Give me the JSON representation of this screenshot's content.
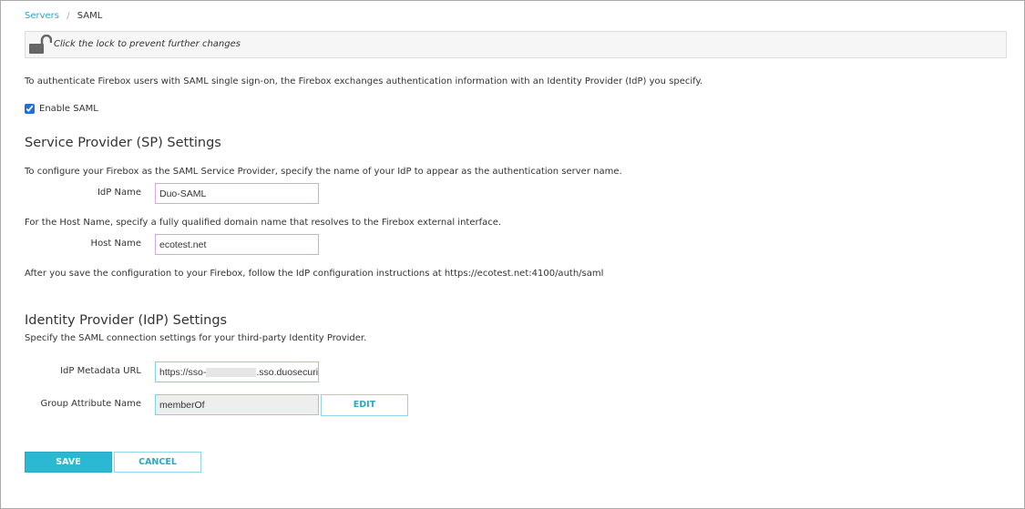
{
  "breadcrumb": {
    "parent": "Servers",
    "separator": "/",
    "current": "SAML"
  },
  "lock": {
    "message": "Click the lock to prevent further changes",
    "icon": "unlocked-padlock-icon"
  },
  "intro": "To authenticate Firebox users with SAML single sign-on, the Firebox exchanges authentication information with an Identity Provider (IdP) you specify.",
  "enable_saml": {
    "label": "Enable SAML",
    "checked": true
  },
  "sp": {
    "title": "Service Provider (SP) Settings",
    "desc": "To configure your Firebox as the SAML Service Provider, specify the name of your IdP to appear as the authentication server name.",
    "idp_name_label": "IdP Name",
    "idp_name_value": "Duo-SAML",
    "host_desc": "For the Host Name, specify a fully qualified domain name that resolves to the Firebox external interface.",
    "host_label": "Host Name",
    "host_value": "ecotest.net",
    "after_save": "After you save the configuration to your Firebox, follow the IdP configuration instructions at https://ecotest.net:4100/auth/saml"
  },
  "idp": {
    "title": "Identity Provider (IdP) Settings",
    "desc": "Specify the SAML connection settings for your third-party Identity Provider.",
    "metadata_label": "IdP Metadata URL",
    "metadata_prefix": "https://sso-",
    "metadata_suffix": ".sso.duosecurity.c",
    "group_label": "Group Attribute Name",
    "group_value": "memberOf",
    "edit_label": "EDIT"
  },
  "actions": {
    "save": "SAVE",
    "cancel": "CANCEL"
  },
  "colors": {
    "accent": "#2bb8d3",
    "link": "#2aa8c4"
  }
}
